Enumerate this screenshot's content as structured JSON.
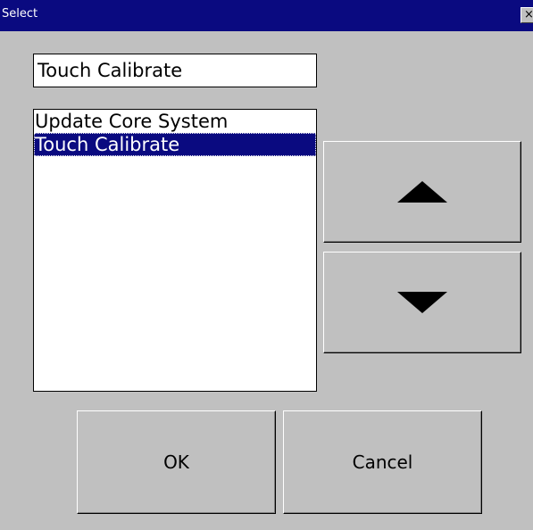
{
  "window": {
    "title": "Select",
    "close_label": "×"
  },
  "selection": {
    "value": "Touch Calibrate"
  },
  "list": {
    "items": [
      {
        "label": "Update Core System",
        "selected": false
      },
      {
        "label": "Touch Calibrate",
        "selected": true
      }
    ]
  },
  "buttons": {
    "move_up_icon": "triangle-up",
    "move_down_icon": "triangle-down",
    "ok_label": "OK",
    "cancel_label": "Cancel"
  },
  "colors": {
    "titlebar": "#0a0a80",
    "selection_bg": "#0a0a80",
    "dialog_bg": "#c0c0c0"
  }
}
